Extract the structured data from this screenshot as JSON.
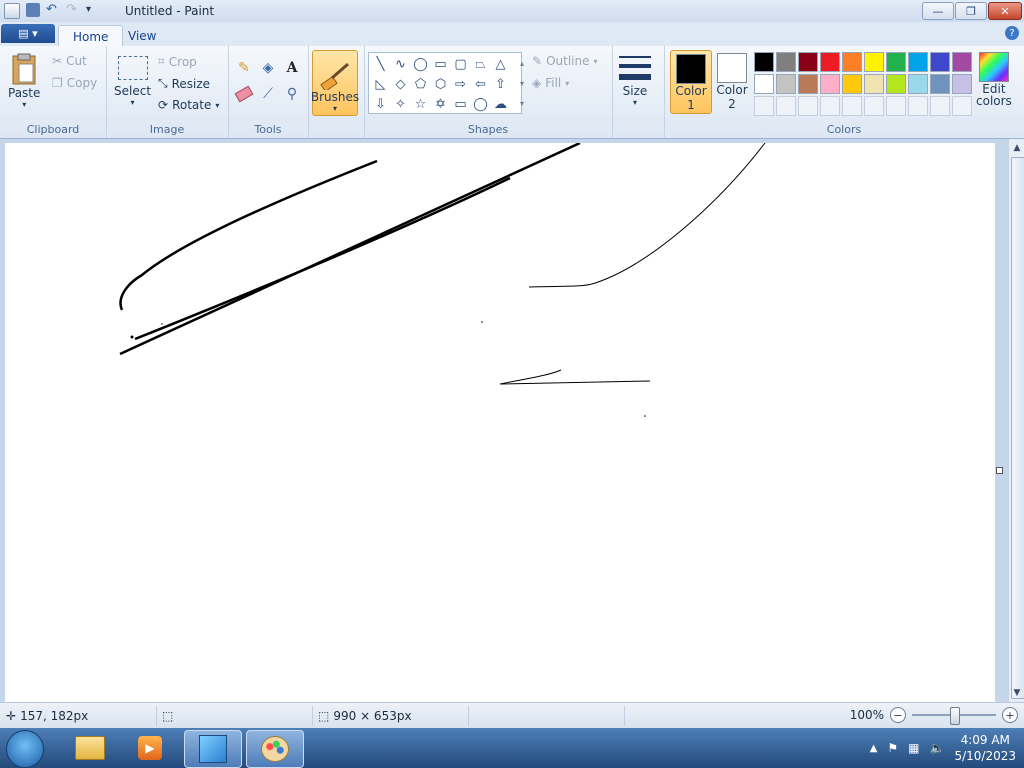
{
  "window": {
    "title": "Untitled - Paint"
  },
  "tabs": [
    {
      "label": "Home",
      "active": true
    },
    {
      "label": "View",
      "active": false
    }
  ],
  "ribbon": {
    "clipboard": {
      "label": "Clipboard",
      "paste": "Paste",
      "cut": "Cut",
      "copy": "Copy"
    },
    "image": {
      "label": "Image",
      "select": "Select",
      "crop": "Crop",
      "resize": "Resize",
      "rotate": "Rotate"
    },
    "tools": {
      "label": "Tools"
    },
    "brushes": {
      "label": "Brushes"
    },
    "shapes": {
      "label": "Shapes",
      "outline": "Outline",
      "fill": "Fill"
    },
    "size": {
      "label": "Size"
    },
    "colors": {
      "label": "Colors",
      "color1": "Color",
      "color1_num": "1",
      "color2": "Color",
      "color2_num": "2",
      "edit1": "Edit",
      "edit2": "colors",
      "color1_value": "#000000",
      "color2_value": "#ffffff",
      "palette": [
        "#000000",
        "#7f7f7f",
        "#880015",
        "#ed1c24",
        "#ff7f27",
        "#fff200",
        "#22b14c",
        "#00a2e8",
        "#3f48cc",
        "#a349a4",
        "#ffffff",
        "#c3c3c3",
        "#b97a57",
        "#ffaec9",
        "#ffc90e",
        "#efe4b0",
        "#b5e61d",
        "#99d9ea",
        "#7092be",
        "#c8bfe7"
      ]
    }
  },
  "status": {
    "cursor": "157, 182px",
    "canvas_size": "990 × 653px",
    "zoom": "100%"
  },
  "taskbar": {
    "time": "4:09 AM",
    "date": "5/10/2023"
  }
}
